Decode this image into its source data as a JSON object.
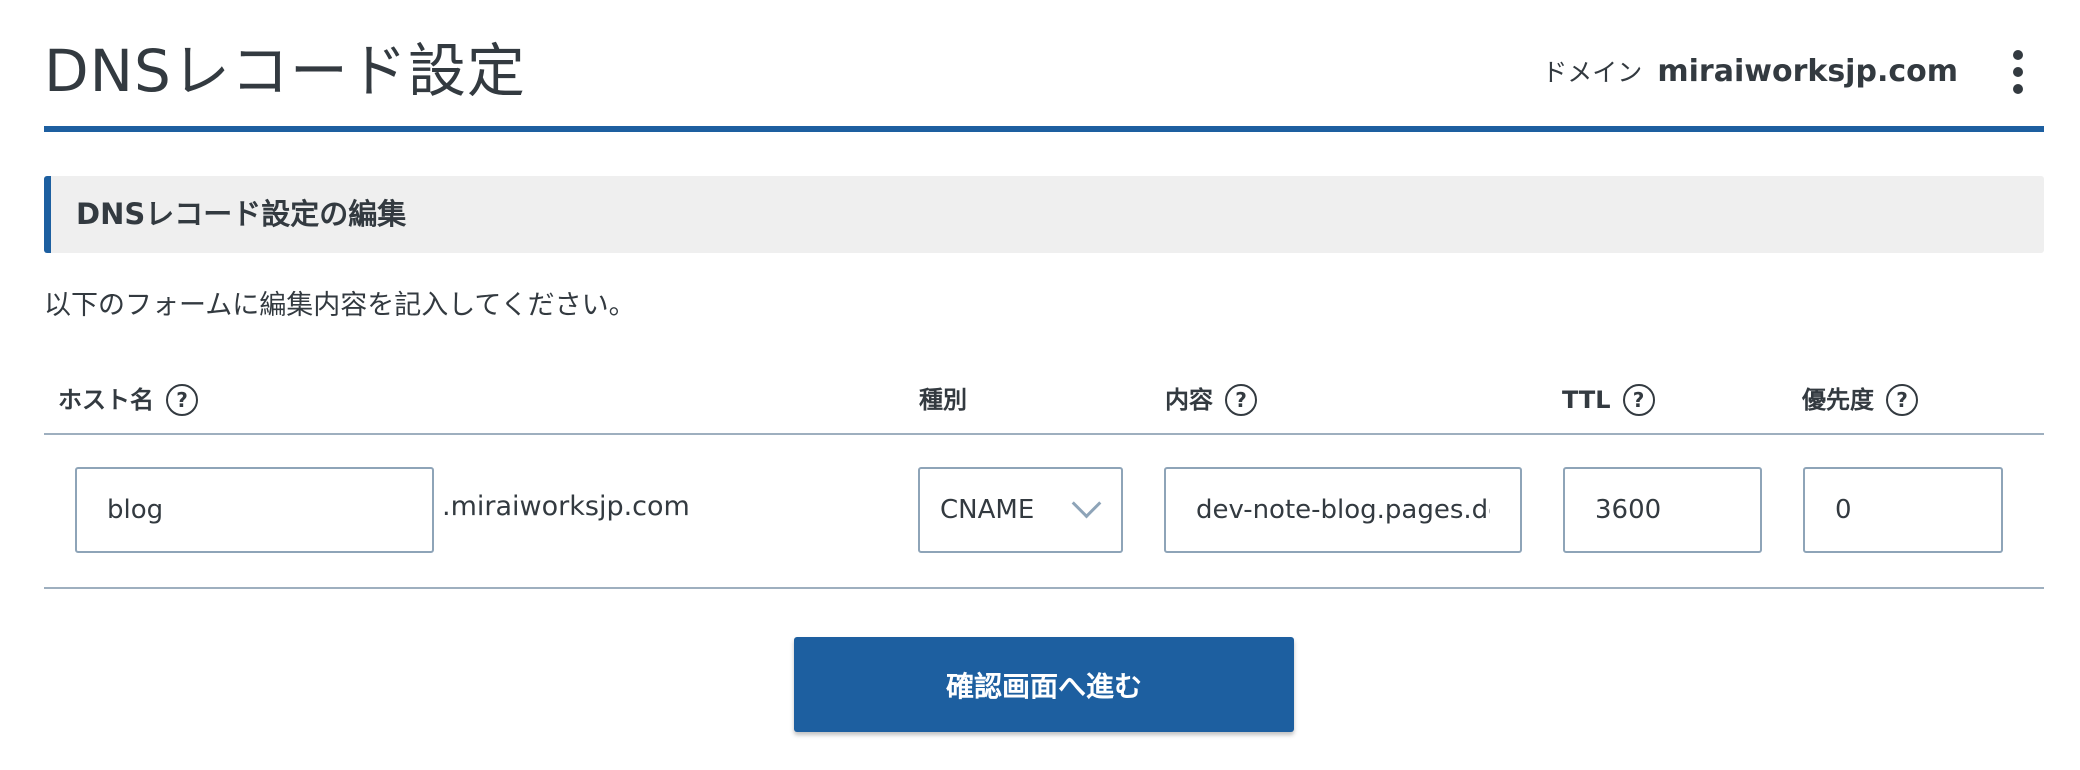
{
  "header": {
    "title": "DNSレコード設定",
    "domain_label": "ドメイン",
    "domain_value": "miraiworksjp.com",
    "menu_icon": "kebab-vertical-icon"
  },
  "section": {
    "title": "DNSレコード設定の編集",
    "instruction": "以下のフォームに編集内容を記入してください。"
  },
  "table": {
    "columns": {
      "host": "ホスト名",
      "type": "種別",
      "content": "内容",
      "ttl": "TTL",
      "priority": "優先度"
    },
    "help_glyph": "?",
    "row": {
      "host_value": "blog",
      "host_suffix": ".miraiworksjp.com",
      "type_value": "CNAME",
      "content_value": "dev-note-blog.pages.dev",
      "ttl_value": "3600",
      "priority_value": "0"
    }
  },
  "actions": {
    "confirm_label": "確認画面へ進む"
  },
  "colors": {
    "accent": "#1d5fa0",
    "text": "#333a40",
    "border": "#8ea4b8",
    "section_bg": "#efefef"
  }
}
